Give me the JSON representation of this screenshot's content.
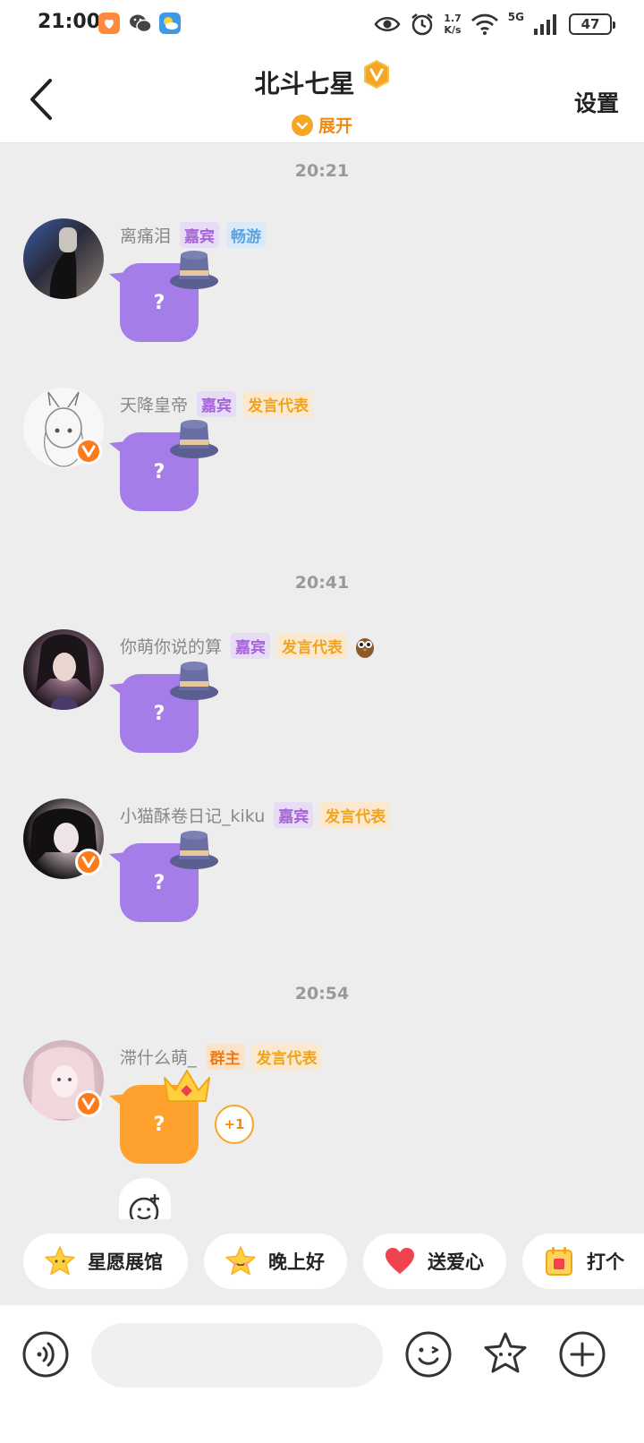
{
  "status_bar": {
    "time": "21:00",
    "net_speed_value": "1.7",
    "net_speed_unit": "K/s",
    "network": "5G",
    "battery": "47",
    "icons": [
      "weibo-app-icon",
      "wechat-icon",
      "weather-icon",
      "eye-icon",
      "alarm-icon",
      "wifi-icon",
      "signal-icon"
    ]
  },
  "header": {
    "title": "北斗七星",
    "expand_label": "展开",
    "settings_label": "设置"
  },
  "chat": {
    "groups": [
      {
        "time": "20:21",
        "messages": [
          {
            "username": "离痛泪",
            "tags": [
              "嘉宾",
              "畅游"
            ],
            "bubble_text": "?"
          },
          {
            "username": "天降皇帝",
            "tags": [
              "嘉宾",
              "发言代表"
            ],
            "bubble_text": "?"
          }
        ]
      },
      {
        "time": "20:41",
        "messages": [
          {
            "username": "你萌你说的算",
            "tags": [
              "嘉宾",
              "发言代表"
            ],
            "bubble_text": "?",
            "extra_icon": "owl-icon"
          },
          {
            "username": "小猫酥卷日记_kiku",
            "tags": [
              "嘉宾",
              "发言代表"
            ],
            "bubble_text": "?"
          }
        ]
      },
      {
        "time": "20:54",
        "messages": [
          {
            "username": "滞什么萌_",
            "tags": [
              "群主",
              "发言代表"
            ],
            "bubble_text": "?",
            "plus_label": "+1"
          }
        ]
      }
    ]
  },
  "quick_replies": [
    "星愿展馆",
    "晚上好",
    "送爱心",
    "打个"
  ],
  "input": {
    "placeholder": ""
  },
  "colors": {
    "accent_orange": "#f5a623",
    "bubble_purple": "#a47de8",
    "bubble_orange": "#ffa12e",
    "background": "#ededed"
  }
}
